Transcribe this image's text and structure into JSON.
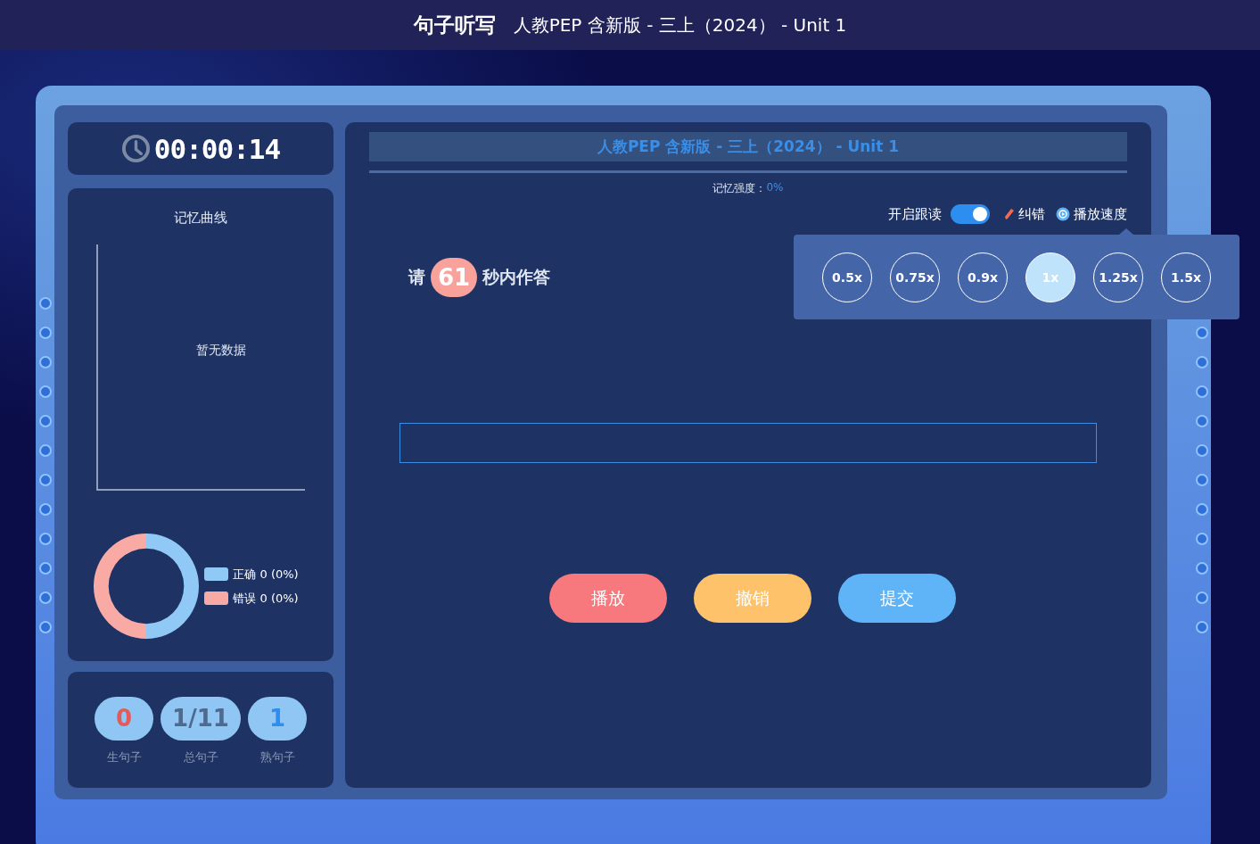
{
  "top_bar": {
    "title": "句子听写",
    "subtitle": "人教PEP 含新版 - 三上（2024） - Unit 1"
  },
  "timer": {
    "time": "00:00:14"
  },
  "memory_curve": {
    "title": "记忆曲线",
    "empty_text": "暂无数据"
  },
  "result_legend": [
    {
      "label": "正确 0 (0%)",
      "color": "#90c8f6"
    },
    {
      "label": "错误 0 (0%)",
      "color": "#f9aaa5"
    }
  ],
  "stats": [
    {
      "value": "0",
      "label": "生句子",
      "kind": "new"
    },
    {
      "value": "1/11",
      "label": "总句子",
      "kind": "total"
    },
    {
      "value": "1",
      "label": "熟句子",
      "kind": "known"
    }
  ],
  "lesson_header": "人教PEP 含新版 - 三上（2024） - Unit 1",
  "memory_strength": {
    "label": "记忆强度：",
    "value": "0%"
  },
  "follow_read": {
    "label": "开启跟读",
    "on": true
  },
  "correction_label": "纠错",
  "speed_label": "播放速度",
  "speed_options": [
    {
      "label": "0.5x",
      "selected": false
    },
    {
      "label": "0.75x",
      "selected": false
    },
    {
      "label": "0.9x",
      "selected": false
    },
    {
      "label": "1x",
      "selected": true
    },
    {
      "label": "1.25x",
      "selected": false
    },
    {
      "label": "1.5x",
      "selected": false
    }
  ],
  "countdown": {
    "before": "请",
    "seconds": "61",
    "after": "秒内作答"
  },
  "buttons": [
    {
      "label": "播放",
      "kind": "play"
    },
    {
      "label": "撤销",
      "kind": "undo"
    },
    {
      "label": "提交",
      "kind": "submit"
    }
  ]
}
